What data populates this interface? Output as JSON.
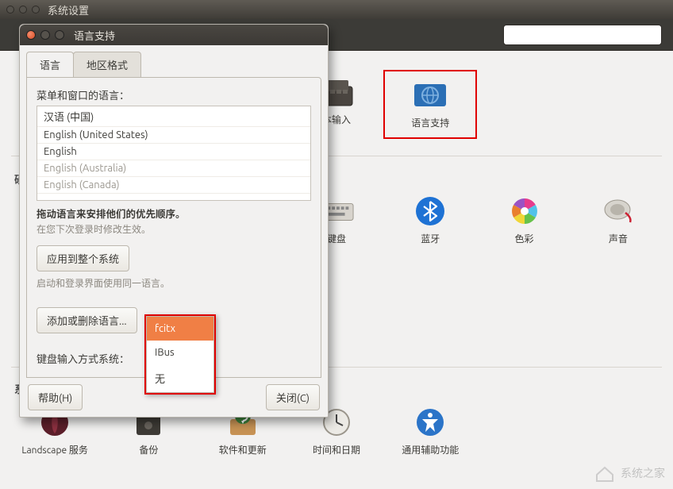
{
  "main": {
    "title": "系统设置",
    "search_placeholder": "",
    "sections": {
      "hardware": "硬",
      "system": "系"
    },
    "items": {
      "text_input": "本输入",
      "language_support": "语言支持",
      "keyboard": "键盘",
      "bluetooth": "蓝牙",
      "color": "色彩",
      "sound": "声音",
      "landscape": "Landscape 服务",
      "backup": "备份",
      "software_updates": "软件和更新",
      "time_date": "时间和日期",
      "accessibility": "通用辅助功能"
    }
  },
  "dialog": {
    "title": "语言支持",
    "tabs": {
      "language": "语言",
      "region": "地区格式"
    },
    "labels": {
      "menu_window_lang": "菜单和窗口的语言：",
      "drag_hint": "拖动语言来安排他们的优先顺序。",
      "effect_hint": "在您下次登录时修改生效。",
      "apply_system": "应用到整个系统",
      "login_hint": "启动和登录界面使用同一语言。",
      "add_remove": "添加或删除语言...",
      "keyboard_method": "键盘输入方式系统：",
      "help": "帮助(H)",
      "close": "关闭(C)"
    },
    "languages": [
      {
        "label": "汉语 (中国)",
        "dim": false
      },
      {
        "label": "English (United States)",
        "dim": false
      },
      {
        "label": "English",
        "dim": false
      },
      {
        "label": "English (Australia)",
        "dim": true
      },
      {
        "label": "English (Canada)",
        "dim": true
      }
    ],
    "dropdown": {
      "items": [
        "fcitx",
        "IBus",
        "无"
      ],
      "selected_index": 0
    }
  },
  "watermark": "系统之家"
}
